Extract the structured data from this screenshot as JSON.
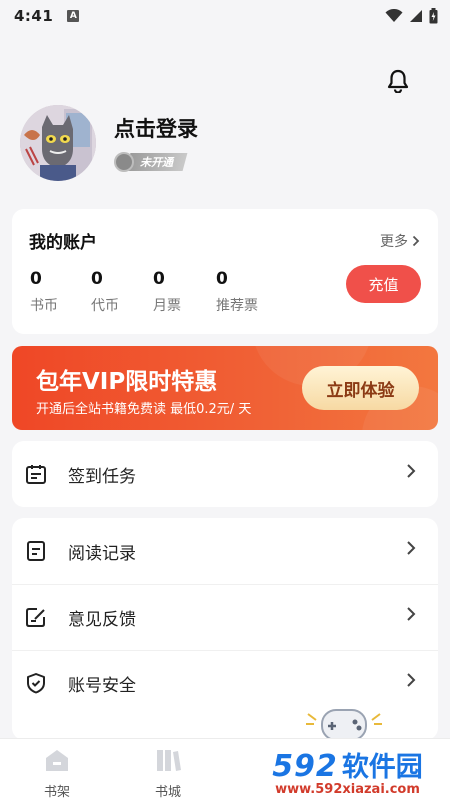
{
  "status_bar": {
    "time": "4:41",
    "notification_icon": "A"
  },
  "profile": {
    "login_text": "点击登录",
    "level_badge": "未开通"
  },
  "account": {
    "title": "我的账户",
    "more": "更多",
    "stats": [
      {
        "value": "0",
        "label": "书币"
      },
      {
        "value": "0",
        "label": "代币"
      },
      {
        "value": "0",
        "label": "月票"
      },
      {
        "value": "0",
        "label": "推荐票"
      }
    ],
    "recharge": "充值"
  },
  "vip": {
    "title": "包年VIP限时特惠",
    "subtitle": "开通后全站书籍免费读 最低0.2元/ 天",
    "button": "立即体验"
  },
  "menu": {
    "checkin": "签到任务",
    "items": [
      {
        "label": "阅读记录",
        "icon": "reading-record-icon"
      },
      {
        "label": "意见反馈",
        "icon": "feedback-icon"
      },
      {
        "label": "账号安全",
        "icon": "shield-icon"
      }
    ]
  },
  "bottom_nav": [
    {
      "label": "书架",
      "icon": "bookshelf-icon"
    },
    {
      "label": "书城",
      "icon": "bookstore-icon"
    }
  ],
  "watermark": {
    "logo_num": "592",
    "logo_text": "软件园",
    "url": "www.592xiazai.com"
  },
  "colors": {
    "accent": "#f0504a",
    "vip_gradient_start": "#ef4726",
    "vip_button_text": "#8b3a14",
    "watermark_blue": "#1a75e3"
  }
}
